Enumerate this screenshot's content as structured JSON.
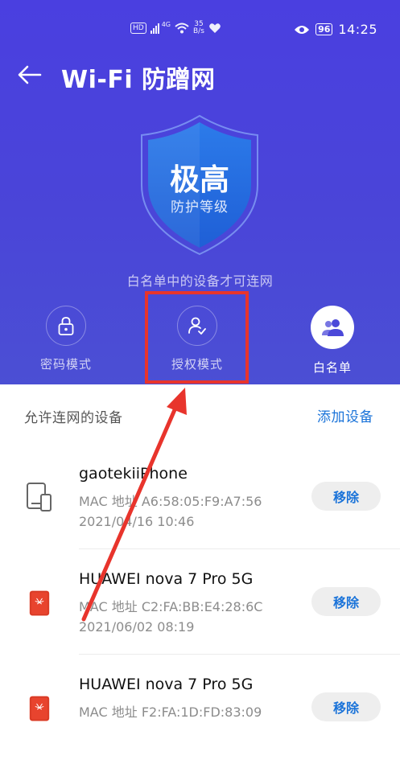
{
  "status_bar": {
    "left_chip": "HD",
    "network": "4G",
    "speed_value": "35",
    "speed_unit": "B/s",
    "battery": "96",
    "time": "14:25"
  },
  "header": {
    "title": "Wi-Fi 防蹭网",
    "protection_level": "极高",
    "protection_label": "防护等级",
    "mode_description": "白名单中的设备才可连网"
  },
  "modes": [
    {
      "label": "密码模式",
      "icon": "lock-icon",
      "active": false
    },
    {
      "label": "授权模式",
      "icon": "user-check-icon",
      "active": false
    },
    {
      "label": "白名单",
      "icon": "users-icon",
      "active": true
    }
  ],
  "devices_section": {
    "title": "允许连网的设备",
    "add_label": "添加设备"
  },
  "devices": [
    {
      "name": "gaotekiiPhone",
      "mac": "MAC 地址 A6:58:05:F9:A7:56",
      "date": "2021/04/16 10:46",
      "icon": "tablet-phone-icon",
      "remove_label": "移除"
    },
    {
      "name": "HUAWEI nova 7 Pro 5G",
      "mac": "MAC 地址 C2:FA:BB:E4:28:6C",
      "date": "2021/06/02 08:19",
      "icon": "huawei-phone-icon",
      "remove_label": "移除"
    },
    {
      "name": "HUAWEI nova 7 Pro 5G",
      "mac": "MAC 地址 F2:FA:1D:FD:83:09",
      "date": "",
      "icon": "huawei-phone-icon",
      "remove_label": "移除"
    }
  ],
  "colors": {
    "header_bg": "#4a45d8",
    "accent_blue": "#1a73d9",
    "annotation_red": "#e8342c",
    "shield_blue": "#1f6fe0"
  }
}
